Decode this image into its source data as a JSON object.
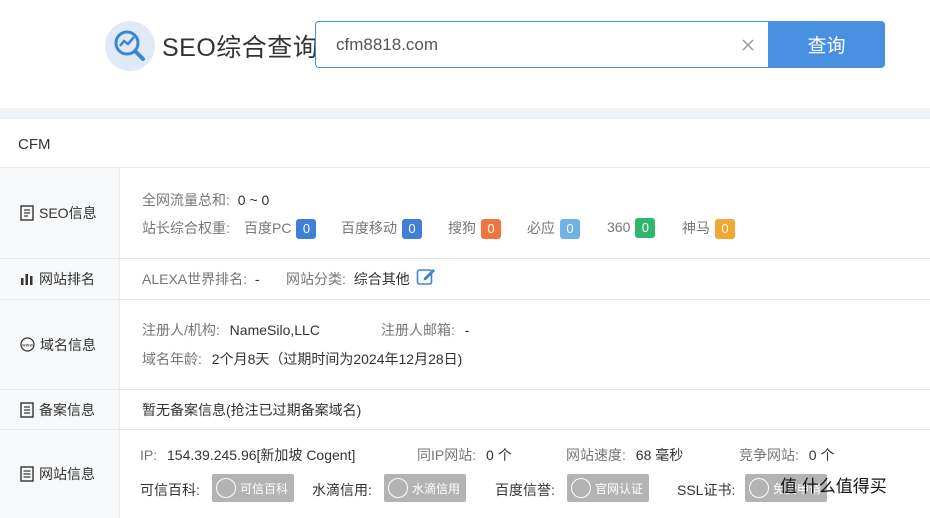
{
  "header": {
    "brand": "SEO综合查询",
    "search_value": "cfm8818.com",
    "search_button": "查询"
  },
  "domain_title": "CFM",
  "seo": {
    "label": "SEO信息",
    "traffic_label": "全网流量总和:",
    "traffic_value": "0 ~ 0",
    "weight_label": "站长综合权重:",
    "weights": [
      {
        "name": "百度PC",
        "value": "0",
        "color": "#3f7fd6"
      },
      {
        "name": "百度移动",
        "value": "0",
        "color": "#3f7fd6"
      },
      {
        "name": "搜狗",
        "value": "0",
        "color": "#f0743e"
      },
      {
        "name": "必应",
        "value": "0",
        "color": "#6fb3e6"
      },
      {
        "name": "360",
        "value": "0",
        "color": "#2fb86c"
      },
      {
        "name": "神马",
        "value": "0",
        "color": "#f3a634"
      }
    ]
  },
  "rank": {
    "label": "网站排名",
    "alexa_label": "ALEXA世界排名:",
    "alexa_value": "-",
    "category_label": "网站分类:",
    "category_value": "综合其他"
  },
  "domain": {
    "label": "域名信息",
    "registrant_label": "注册人/机构:",
    "registrant_value": "NameSilo,LLC",
    "email_label": "注册人邮箱:",
    "email_value": "-",
    "age_label": "域名年龄:",
    "age_value": "2个月8天（过期时间为2024年12月28日)"
  },
  "beian": {
    "label": "备案信息",
    "text": "暂无备案信息(抢注已过期备案域名)"
  },
  "site": {
    "label": "网站信息",
    "ip_label": "IP:",
    "ip_value": "154.39.245.96[新加坡 Cogent]",
    "same_ip_label": "同IP网站:",
    "same_ip_value": "0 个",
    "speed_label": "网站速度:",
    "speed_value": "68 毫秒",
    "competitor_label": "竞争网站:",
    "competitor_value": "0 个",
    "kexin_label": "可信百科:",
    "kexin_seal": "可信百科",
    "shuidi_label": "水滴信用:",
    "shuidi_seal": "水滴信用",
    "baidu_label": "百度信誉:",
    "baidu_seal": "官网认证",
    "ssl_label": "SSL证书:",
    "ssl_seal": "免费申请"
  },
  "watermark": "值 什么值得买"
}
